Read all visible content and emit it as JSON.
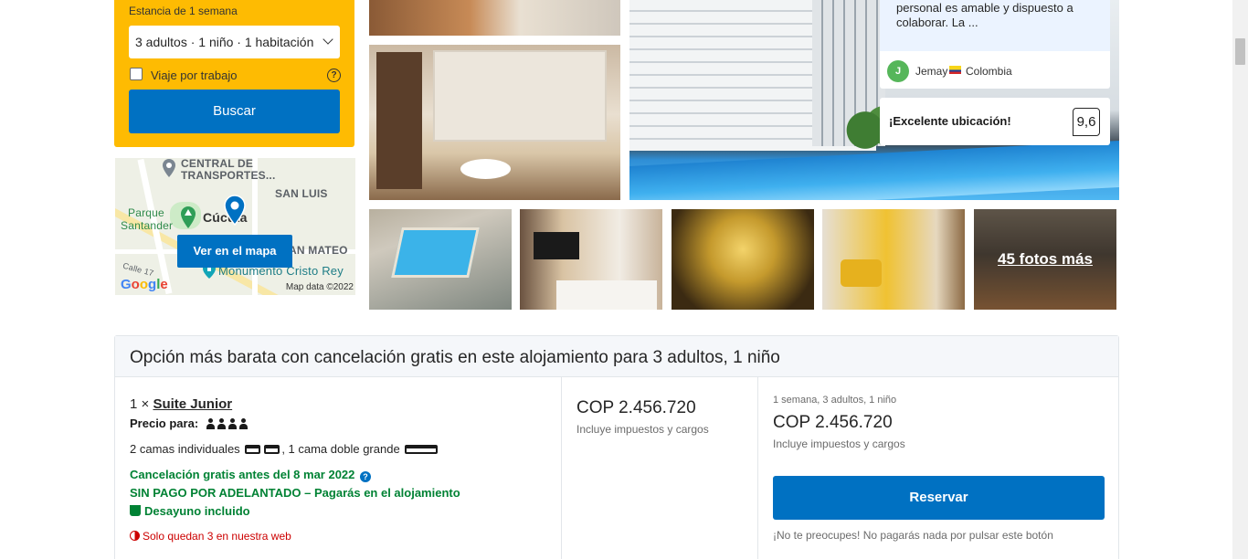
{
  "search": {
    "stay_label": "Estancia de 1 semana",
    "occupancy": "3 adultos · 1 niño · 1 habitación",
    "work_trip_label": "Viaje por trabajo",
    "button_label": "Buscar"
  },
  "map": {
    "labels": {
      "central": "CENTRAL DE",
      "transportes": "TRANSPORTES...",
      "san_luis": "SAN LUIS",
      "parque": "Parque",
      "santander": "Santander",
      "city": "Cúcuta",
      "san_mateo": "AN MATEO",
      "monumento": "Monumento Cristo Rey",
      "calle": "Calle 17"
    },
    "button_label": "Ver en el mapa",
    "google": "Google",
    "credit": "Map data ©2022"
  },
  "gallery": {
    "more_photos": "45 fotos más"
  },
  "review": {
    "quote": "personal es amable y dispuesto a colaborar. La ...",
    "author_initial": "J",
    "author": "Jemay",
    "country": "Colombia"
  },
  "location_score": {
    "label": "¡Excelente ubicación!",
    "score": "9,6"
  },
  "offer": {
    "heading": "Opción más barata con cancelación gratis en este alojamiento para 3 adultos, 1 niño",
    "room_qty": "1 ×",
    "room_name": "Suite Junior",
    "capacity_label": "Precio para:",
    "capacity_count": 4,
    "beds_text_1": "2 camas individuales",
    "beds_text_2": ", 1 cama doble grande",
    "free_cancel": "Cancelación gratis antes del 8 mar 2022",
    "no_prepay": "SIN PAGO POR ADELANTADO – Pagarás en el alojamiento",
    "breakfast": "Desayuno incluido",
    "urgency": "Solo quedan 3 en nuestra web",
    "price": "COP 2.456.720",
    "price_note": "Incluye impuestos y cargos",
    "summary_stay": "1 semana, 3 adultos, 1 niño",
    "summary_price": "COP 2.456.720",
    "summary_note": "Incluye impuestos y cargos",
    "reserve_label": "Reservar",
    "reserve_note": "¡No te preocupes! No pagarás nada por pulsar este botón"
  },
  "colors": {
    "search_panel": "#febb02",
    "primary_button": "#0071c2",
    "green_text": "#008234",
    "urgent_text": "#cc0000",
    "review_bg": "#ebf3ff"
  }
}
